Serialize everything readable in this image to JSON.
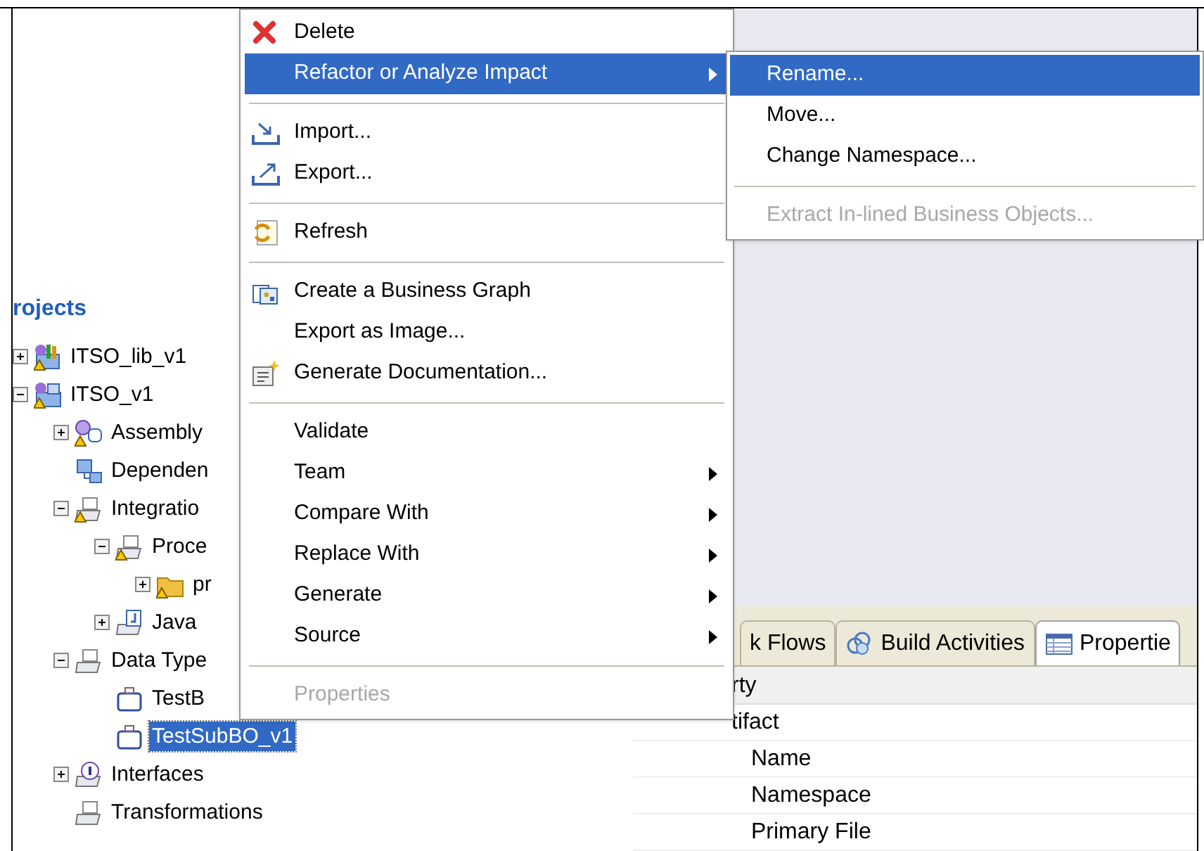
{
  "explorer": {
    "title": "rojects",
    "tree": [
      {
        "label": "ITSO_lib_v1",
        "warning": true,
        "expanded": false,
        "selected": false
      },
      {
        "label": "ITSO_v1",
        "warning": true,
        "expanded": true,
        "selected": false,
        "children": [
          {
            "label": "Assembly",
            "warning": true,
            "expanded": false,
            "selected": false
          },
          {
            "label": "Dependen",
            "warning": false,
            "selected": false
          },
          {
            "label": "Integratio",
            "warning": true,
            "expanded": true,
            "selected": false,
            "children": [
              {
                "label": "Proce",
                "warning": true,
                "expanded": true,
                "selected": false,
                "children": [
                  {
                    "label": "pr",
                    "warning": true,
                    "expanded": false,
                    "selected": false
                  }
                ]
              },
              {
                "label": "Java",
                "warning": false,
                "expanded": false,
                "selected": false
              }
            ]
          },
          {
            "label": "Data Type",
            "warning": false,
            "expanded": true,
            "selected": false,
            "children": [
              {
                "label": "TestB",
                "warning": false,
                "selected": false
              },
              {
                "label": "TestSubBO_v1",
                "warning": false,
                "selected": true
              }
            ]
          },
          {
            "label": "Interfaces",
            "warning": false,
            "expanded": false,
            "selected": false
          },
          {
            "label": "Transformations",
            "warning": false,
            "selected": false
          }
        ]
      }
    ]
  },
  "bottom_panel": {
    "tabs": [
      {
        "label": "k Flows",
        "selected": false
      },
      {
        "label": "Build Activities",
        "selected": false
      },
      {
        "label": "Propertie",
        "selected": true
      }
    ],
    "table": {
      "header": "rty",
      "rows": [
        {
          "label": "tifact",
          "indented": false
        },
        {
          "label": "Name",
          "indented": true
        },
        {
          "label": "Namespace",
          "indented": true
        },
        {
          "label": "Primary File",
          "indented": true
        }
      ]
    }
  },
  "context_menu": {
    "items": [
      {
        "kind": "item",
        "label": "Delete",
        "selected": false,
        "disabled": false,
        "submenu": false
      },
      {
        "kind": "item",
        "label": "Refactor or Analyze Impact",
        "selected": true,
        "disabled": false,
        "submenu": true
      },
      {
        "kind": "separator"
      },
      {
        "kind": "item",
        "label": "Import...",
        "selected": false,
        "disabled": false,
        "submenu": false
      },
      {
        "kind": "item",
        "label": "Export...",
        "selected": false,
        "disabled": false,
        "submenu": false
      },
      {
        "kind": "separator"
      },
      {
        "kind": "item",
        "label": "Refresh",
        "selected": false,
        "disabled": false,
        "submenu": false
      },
      {
        "kind": "separator"
      },
      {
        "kind": "item",
        "label": "Create a Business Graph",
        "selected": false,
        "disabled": false,
        "submenu": false
      },
      {
        "kind": "item",
        "label": "Export as Image...",
        "selected": false,
        "disabled": false,
        "submenu": false
      },
      {
        "kind": "item",
        "label": "Generate Documentation...",
        "selected": false,
        "disabled": false,
        "submenu": false
      },
      {
        "kind": "separator"
      },
      {
        "kind": "item",
        "label": "Validate",
        "selected": false,
        "disabled": false,
        "submenu": false
      },
      {
        "kind": "item",
        "label": "Team",
        "selected": false,
        "disabled": false,
        "submenu": true
      },
      {
        "kind": "item",
        "label": "Compare With",
        "selected": false,
        "disabled": false,
        "submenu": true
      },
      {
        "kind": "item",
        "label": "Replace With",
        "selected": false,
        "disabled": false,
        "submenu": true
      },
      {
        "kind": "item",
        "label": "Generate",
        "selected": false,
        "disabled": false,
        "submenu": true
      },
      {
        "kind": "item",
        "label": "Source",
        "selected": false,
        "disabled": false,
        "submenu": true
      },
      {
        "kind": "separator"
      },
      {
        "kind": "item",
        "label": "Properties",
        "selected": false,
        "disabled": true,
        "submenu": false
      }
    ]
  },
  "submenu": {
    "items": [
      {
        "kind": "item",
        "label": "Rename...",
        "selected": true,
        "disabled": false
      },
      {
        "kind": "item",
        "label": "Move...",
        "selected": false,
        "disabled": false
      },
      {
        "kind": "item",
        "label": "Change Namespace...",
        "selected": false,
        "disabled": false
      },
      {
        "kind": "separator"
      },
      {
        "kind": "item",
        "label": "Extract In-lined Business Objects...",
        "selected": false,
        "disabled": true
      }
    ]
  }
}
